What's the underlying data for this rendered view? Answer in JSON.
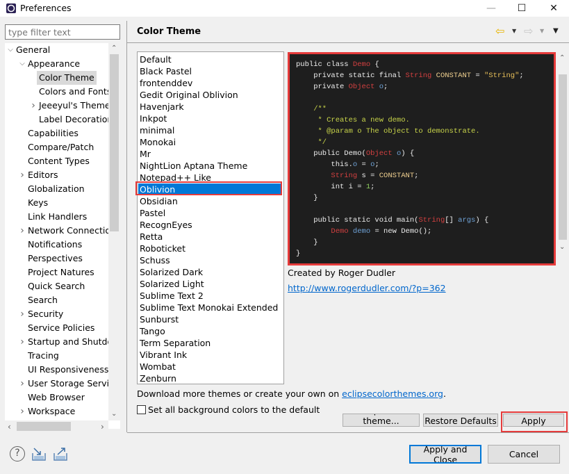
{
  "window": {
    "title": "Preferences",
    "minimize": "—",
    "maximize": "☐",
    "close": "✕"
  },
  "sidebar": {
    "filter_placeholder": "type filter text",
    "tree": [
      {
        "label": "General",
        "level": 0,
        "expander": "expanded"
      },
      {
        "label": "Appearance",
        "level": 1,
        "expander": "expanded"
      },
      {
        "label": "Color Theme",
        "level": 2,
        "expander": "none",
        "selected": true
      },
      {
        "label": "Colors and Fonts",
        "level": 2,
        "expander": "none"
      },
      {
        "label": "Jeeeyul's Themes",
        "level": 2,
        "expander": "collapsed"
      },
      {
        "label": "Label Decorations",
        "level": 2,
        "expander": "none"
      },
      {
        "label": "Capabilities",
        "level": 1,
        "expander": "none"
      },
      {
        "label": "Compare/Patch",
        "level": 1,
        "expander": "none"
      },
      {
        "label": "Content Types",
        "level": 1,
        "expander": "none"
      },
      {
        "label": "Editors",
        "level": 1,
        "expander": "collapsed"
      },
      {
        "label": "Globalization",
        "level": 1,
        "expander": "none"
      },
      {
        "label": "Keys",
        "level": 1,
        "expander": "none"
      },
      {
        "label": "Link Handlers",
        "level": 1,
        "expander": "none"
      },
      {
        "label": "Network Connections",
        "level": 1,
        "expander": "collapsed"
      },
      {
        "label": "Notifications",
        "level": 1,
        "expander": "none"
      },
      {
        "label": "Perspectives",
        "level": 1,
        "expander": "none"
      },
      {
        "label": "Project Natures",
        "level": 1,
        "expander": "none"
      },
      {
        "label": "Quick Search",
        "level": 1,
        "expander": "none"
      },
      {
        "label": "Search",
        "level": 1,
        "expander": "none"
      },
      {
        "label": "Security",
        "level": 1,
        "expander": "collapsed"
      },
      {
        "label": "Service Policies",
        "level": 1,
        "expander": "none"
      },
      {
        "label": "Startup and Shutdown",
        "level": 1,
        "expander": "collapsed"
      },
      {
        "label": "Tracing",
        "level": 1,
        "expander": "none"
      },
      {
        "label": "UI Responsiveness",
        "level": 1,
        "expander": "none"
      },
      {
        "label": "User Storage Service",
        "level": 1,
        "expander": "collapsed"
      },
      {
        "label": "Web Browser",
        "level": 1,
        "expander": "none"
      },
      {
        "label": "Workspace",
        "level": 1,
        "expander": "collapsed"
      }
    ]
  },
  "page": {
    "title": "Color Theme",
    "nav": {
      "back": "⇦",
      "forward": "⇨",
      "menu": "▼"
    },
    "themes": [
      "Default",
      "Black Pastel",
      "frontenddev",
      "Gedit Original Oblivion",
      "Havenjark",
      "Inkpot",
      "minimal",
      "Monokai",
      "Mr",
      "NightLion Aptana Theme",
      "Notepad++ Like",
      "Oblivion",
      "Obsidian",
      "Pastel",
      "RecognEyes",
      "Retta",
      "Roboticket",
      "Schuss",
      "Solarized Dark",
      "Solarized Light",
      "Sublime Text 2",
      "Sublime Text Monokai Extended",
      "Sunburst",
      "Tango",
      "Term Separation",
      "Vibrant Ink",
      "Wombat",
      "Zenburn"
    ],
    "selected_theme": "Oblivion",
    "preview_code": [
      [
        [
          "kw",
          "public class "
        ],
        [
          "type",
          "Demo"
        ],
        [
          "kw",
          " {"
        ]
      ],
      [
        [
          "kw",
          "    private static final "
        ],
        [
          "type",
          "String"
        ],
        [
          "const",
          " CONSTANT"
        ],
        [
          "kw",
          " = "
        ],
        [
          "str",
          "\"String\""
        ],
        [
          "kw",
          ";"
        ]
      ],
      [
        [
          "kw",
          "    private "
        ],
        [
          "type",
          "Object"
        ],
        [
          "var",
          " o"
        ],
        [
          "kw",
          ";"
        ]
      ],
      [
        [
          "kw",
          ""
        ]
      ],
      [
        [
          "cm",
          "    /**"
        ]
      ],
      [
        [
          "cm",
          "     * Creates a new demo."
        ]
      ],
      [
        [
          "cm",
          "     * @param o The object to demonstrate."
        ]
      ],
      [
        [
          "cm",
          "     */"
        ]
      ],
      [
        [
          "kw",
          "    public Demo("
        ],
        [
          "type",
          "Object"
        ],
        [
          "var",
          " o"
        ],
        [
          "kw",
          ") {"
        ]
      ],
      [
        [
          "kw",
          "        this."
        ],
        [
          "var",
          "o"
        ],
        [
          "kw",
          " = "
        ],
        [
          "var",
          "o"
        ],
        [
          "kw",
          ";"
        ]
      ],
      [
        [
          "type",
          "        String"
        ],
        [
          "kw",
          " s = "
        ],
        [
          "const",
          "CONSTANT"
        ],
        [
          "kw",
          ";"
        ]
      ],
      [
        [
          "kw",
          "        int i = "
        ],
        [
          "num",
          "1"
        ],
        [
          "kw",
          ";"
        ]
      ],
      [
        [
          "kw",
          "    }"
        ]
      ],
      [
        [
          "kw",
          ""
        ]
      ],
      [
        [
          "kw",
          "    public static void main("
        ],
        [
          "type",
          "String"
        ],
        [
          "kw",
          "[] "
        ],
        [
          "var",
          "args"
        ],
        [
          "kw",
          ") {"
        ]
      ],
      [
        [
          "type",
          "        Demo"
        ],
        [
          "var",
          " demo"
        ],
        [
          "kw",
          " = new Demo();"
        ]
      ],
      [
        [
          "kw",
          "    }"
        ]
      ],
      [
        [
          "kw",
          "}"
        ]
      ]
    ],
    "created_by": "Created by Roger Dudler",
    "author_url": "http://www.rogerdudler.com/?p=362",
    "download_prefix": "Download more themes or create your own on ",
    "download_link": "eclipsecolorthemes.org",
    "download_suffix": ".",
    "bg_default_label": "Set all background colors to the default",
    "bg_default_checked": false,
    "import_button": "Import a theme...",
    "restore_button": "Restore Defaults",
    "apply_button": "Apply"
  },
  "footer": {
    "apply_close_button": "Apply and Close",
    "cancel_button": "Cancel"
  },
  "colors": {
    "selection": "#0078d7",
    "annotation_red": "#e53b3b",
    "preview_bg": "#1e1e1e",
    "link": "#0066cc"
  }
}
